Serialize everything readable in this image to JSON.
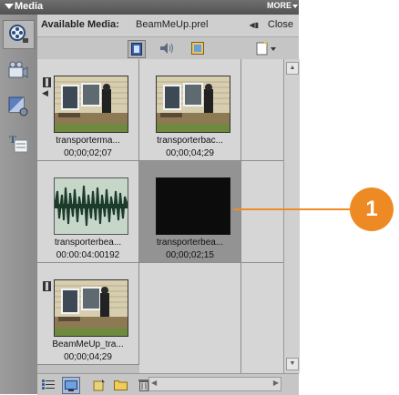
{
  "panel": {
    "title": "Media",
    "more_label": "MORE",
    "header_label": "Available Media:",
    "file_name": "BeamMeUp.prel",
    "close_label": "Close"
  },
  "rail": {
    "items": [
      "media-icon",
      "movie-icon",
      "effects-icon",
      "titles-icon"
    ]
  },
  "filters": [
    "video-icon",
    "audio-icon",
    "image-icon"
  ],
  "clips": [
    {
      "name": "transporterma...",
      "duration": "00;00;02;07",
      "kind": "video-audio",
      "selected": false
    },
    {
      "name": "transporterbac...",
      "duration": "00;00;04;29",
      "kind": "video",
      "selected": false
    },
    {
      "name": "transporterbea...",
      "duration": "00:00:04:00192",
      "kind": "audio",
      "selected": false
    },
    {
      "name": "transporterbea...",
      "duration": "00;00;02;15",
      "kind": "video-black",
      "selected": true
    },
    {
      "name": "BeamMeUp_tra...",
      "duration": "00;00;04;29",
      "kind": "video",
      "selected": false
    }
  ],
  "callout": {
    "number": "1",
    "color": "#ee8a23"
  }
}
